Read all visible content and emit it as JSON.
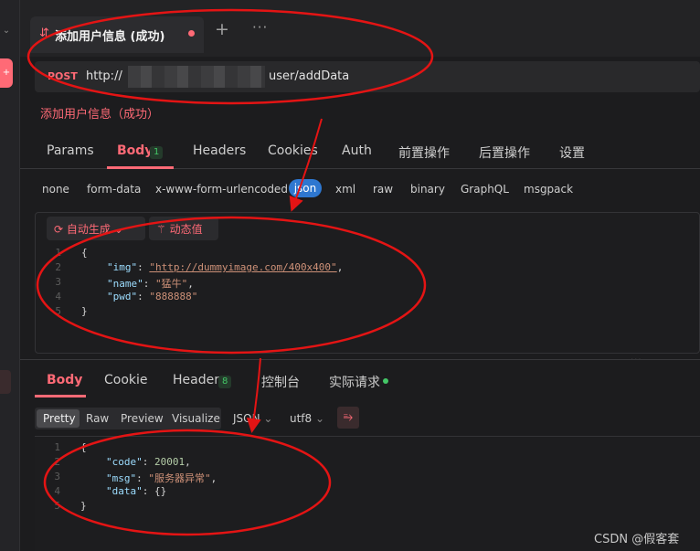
{
  "tab": {
    "title": "添加用户信息 (成功)",
    "plus": "+",
    "more": "···"
  },
  "request": {
    "method": "POST",
    "url_prefix": "http://",
    "url_path": "user/addData",
    "name": "添加用户信息（成功）"
  },
  "req_tabs": [
    {
      "label": "Params"
    },
    {
      "label": "Body",
      "badge": "1"
    },
    {
      "label": "Headers"
    },
    {
      "label": "Cookies"
    },
    {
      "label": "Auth"
    },
    {
      "label": "前置操作"
    },
    {
      "label": "后置操作"
    },
    {
      "label": "设置"
    }
  ],
  "body_types": [
    "none",
    "form-data",
    "x-www-form-urlencoded",
    "json",
    "xml",
    "raw",
    "binary",
    "GraphQL",
    "msgpack"
  ],
  "editor_toolbar": {
    "auto_generate": "自动生成",
    "dynamic_value": "动态值"
  },
  "request_body": {
    "lines": [
      "1",
      "2",
      "3",
      "4",
      "5"
    ],
    "open": "{",
    "close": "}",
    "img_key": "\"img\"",
    "img_val": "\"http://dummyimage.com/400x400\"",
    "name_key": "\"name\"",
    "name_val": "\"猛牛\"",
    "pwd_key": "\"pwd\"",
    "pwd_val": "\"888888\""
  },
  "resp_tabs": [
    {
      "label": "Body"
    },
    {
      "label": "Cookie"
    },
    {
      "label": "Header",
      "badge": "8"
    },
    {
      "label": "控制台"
    },
    {
      "label": "实际请求"
    }
  ],
  "format_options": [
    "Pretty",
    "Raw",
    "Preview",
    "Visualize"
  ],
  "response_type": "JSON",
  "encoding": "utf8",
  "response_body": {
    "lines": [
      "1",
      "2",
      "3",
      "4",
      "5"
    ],
    "open": "{",
    "close": "}",
    "code_key": "\"code\"",
    "code_val": "20001",
    "msg_key": "\"msg\"",
    "msg_val": "\"服务器异常\"",
    "data_key": "\"data\"",
    "data_val": "{}"
  },
  "watermark": "CSDN @假客套",
  "colors": {
    "accent": "#ff6a76",
    "json_pill": "#2e77d0",
    "badge_green": "#44c767",
    "annotation": "#e41414"
  }
}
